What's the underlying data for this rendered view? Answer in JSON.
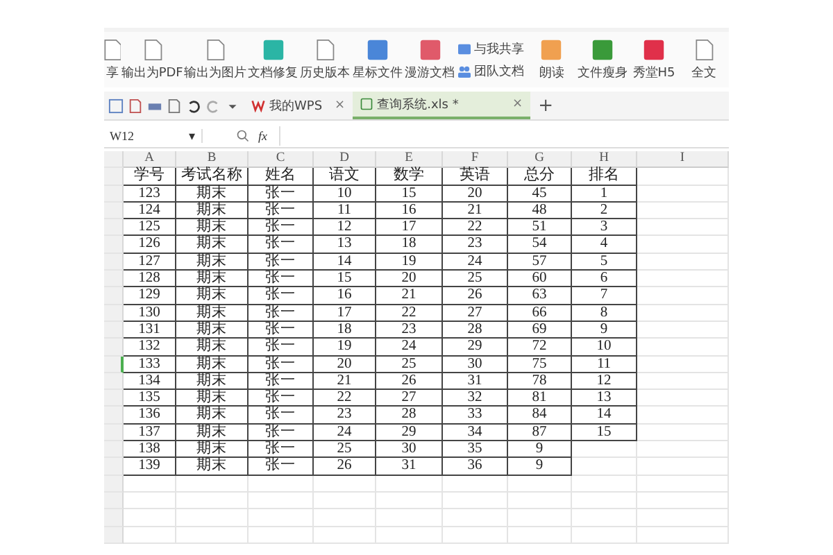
{
  "toolbar": {
    "items": [
      {
        "kind": "partial",
        "label": "享"
      },
      {
        "kind": "pdf",
        "label": "输出为PDF"
      },
      {
        "kind": "image",
        "label": "输出为图片"
      },
      {
        "kind": "repair",
        "label": "文档修复"
      },
      {
        "kind": "history",
        "label": "历史版本"
      },
      {
        "kind": "star",
        "label": "星标文件"
      },
      {
        "kind": "roam",
        "label": "漫游文档"
      },
      {
        "kind": "stack",
        "items": [
          {
            "kind": "shared",
            "label": "与我共享"
          },
          {
            "kind": "team",
            "label": "团队文档"
          }
        ]
      },
      {
        "kind": "read",
        "label": "朗读"
      },
      {
        "kind": "slim",
        "label": "文件瘦身"
      },
      {
        "kind": "h5",
        "label": "秀堂H5"
      },
      {
        "kind": "fulltext",
        "label": "全文"
      }
    ]
  },
  "tabs": [
    {
      "label": "我的WPS",
      "selected": false,
      "close": "×"
    },
    {
      "label": "查询系统.xls *",
      "selected": true,
      "close": "×"
    }
  ],
  "new_tab": "+",
  "formula_bar": {
    "cell": "W12",
    "caret": "▾",
    "fx": "fx"
  },
  "sheet": {
    "columns": [
      "A",
      "B",
      "C",
      "D",
      "E",
      "F",
      "G",
      "H",
      "I"
    ],
    "rows": [
      [
        "学号",
        "考试名称",
        "姓名",
        "语文",
        "数学",
        "英语",
        "总分",
        "排名"
      ],
      [
        "123",
        "期末",
        "张一",
        "10",
        "15",
        "20",
        "45",
        "1"
      ],
      [
        "124",
        "期末",
        "张一",
        "11",
        "16",
        "21",
        "48",
        "2"
      ],
      [
        "125",
        "期末",
        "张一",
        "12",
        "17",
        "22",
        "51",
        "3"
      ],
      [
        "126",
        "期末",
        "张一",
        "13",
        "18",
        "23",
        "54",
        "4"
      ],
      [
        "127",
        "期末",
        "张一",
        "14",
        "19",
        "24",
        "57",
        "5"
      ],
      [
        "128",
        "期末",
        "张一",
        "15",
        "20",
        "25",
        "60",
        "6"
      ],
      [
        "129",
        "期末",
        "张一",
        "16",
        "21",
        "26",
        "63",
        "7"
      ],
      [
        "130",
        "期末",
        "张一",
        "17",
        "22",
        "27",
        "66",
        "8"
      ],
      [
        "131",
        "期末",
        "张一",
        "18",
        "23",
        "28",
        "69",
        "9"
      ],
      [
        "132",
        "期末",
        "张一",
        "19",
        "24",
        "29",
        "72",
        "10"
      ],
      [
        "133",
        "期末",
        "张一",
        "20",
        "25",
        "30",
        "75",
        "11"
      ],
      [
        "134",
        "期末",
        "张一",
        "21",
        "26",
        "31",
        "78",
        "12"
      ],
      [
        "135",
        "期末",
        "张一",
        "22",
        "27",
        "32",
        "81",
        "13"
      ],
      [
        "136",
        "期末",
        "张一",
        "23",
        "28",
        "33",
        "84",
        "14"
      ],
      [
        "137",
        "期末",
        "张一",
        "24",
        "29",
        "34",
        "87",
        "15"
      ],
      [
        "138",
        "期末",
        "张一",
        "25",
        "30",
        "35",
        "9"
      ],
      [
        "139",
        "期末",
        "张一",
        "26",
        "31",
        "36",
        "9"
      ]
    ]
  }
}
